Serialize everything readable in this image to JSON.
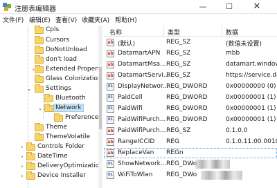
{
  "window": {
    "title": "注册表编辑器",
    "minimize": "—",
    "maximize": "☐",
    "close": "✕"
  },
  "menu": [
    "文件(F)",
    "编辑(E)",
    "查看(V)",
    "收藏夹(A)",
    "帮助(H)"
  ],
  "tree": [
    {
      "label": "Cpls",
      "twisty": ""
    },
    {
      "label": "Cursors",
      "twisty": ""
    },
    {
      "label": "DoNotUnload",
      "twisty": ""
    },
    {
      "label": "don't load",
      "twisty": ""
    },
    {
      "label": "Extended Propert",
      "twisty": "›"
    },
    {
      "label": "Glass Colorization",
      "twisty": ""
    },
    {
      "label": "Settings",
      "twisty": "⌄"
    },
    {
      "label": "Bluetooth",
      "twisty": ""
    },
    {
      "label": "Network",
      "twisty": "⌄"
    },
    {
      "label": "Preferences",
      "twisty": ""
    },
    {
      "label": "Theme",
      "twisty": ""
    },
    {
      "label": "ThemeVolatile",
      "twisty": ""
    },
    {
      "label": "Controls Folder",
      "twisty": "›"
    },
    {
      "label": "DateTime",
      "twisty": "›"
    },
    {
      "label": "DeliveryOptimization",
      "twisty": "›"
    },
    {
      "label": "Device Installer",
      "twisty": "›"
    }
  ],
  "columns": {
    "name": "名称",
    "type": "类型",
    "data": "数据"
  },
  "values": [
    {
      "icon": "ab",
      "name": "(默认)",
      "type": "REG_SZ",
      "data": "(数值未设置)"
    },
    {
      "icon": "ab",
      "name": "DatamartAPN",
      "type": "REG_SZ",
      "data": "mbb"
    },
    {
      "icon": "ab",
      "name": "DatamartMsa...",
      "type": "REG_SZ",
      "data": "datamart.windows"
    },
    {
      "icon": "ab",
      "name": "DatamartServi...",
      "type": "REG_SZ",
      "data": "https://service.data"
    },
    {
      "icon": "01",
      "name": "DisplayNetwor...",
      "type": "REG_DWORD",
      "data": "0x00000000 (0)"
    },
    {
      "icon": "01",
      "name": "PaidCell",
      "type": "REG_DWORD",
      "data": "0x00000001 (1)"
    },
    {
      "icon": "01",
      "name": "PaidWifi",
      "type": "REG_DWORD",
      "data": "0x00000001 (1)"
    },
    {
      "icon": "01",
      "name": "PaidWifiPurch...",
      "type": "REG_DWORD",
      "data": "0x00000001 (1)"
    },
    {
      "icon": "ab",
      "name": "PaidWifiPurch...",
      "type": "REG_SZ",
      "data": "0.1.0.0"
    },
    {
      "icon": "ab",
      "name": "RangeICCID",
      "type": "REG",
      "data": "0.1.0.11.00.001001("
    },
    {
      "icon": "ab",
      "name": "ReplaceVan",
      "type": "REGn",
      "data": ""
    },
    {
      "icon": "01",
      "name": "ShowNetwork...",
      "type": "REG_DWo",
      "data": ""
    },
    {
      "icon": "01",
      "name": "WiFiToWlan",
      "type": "REG_DWo",
      "data": ""
    }
  ],
  "colors": {
    "selection": "#cce4f7",
    "folder": "#f6d56e",
    "string_icon": "#c0392b",
    "dword_icon": "#2a62b8"
  }
}
